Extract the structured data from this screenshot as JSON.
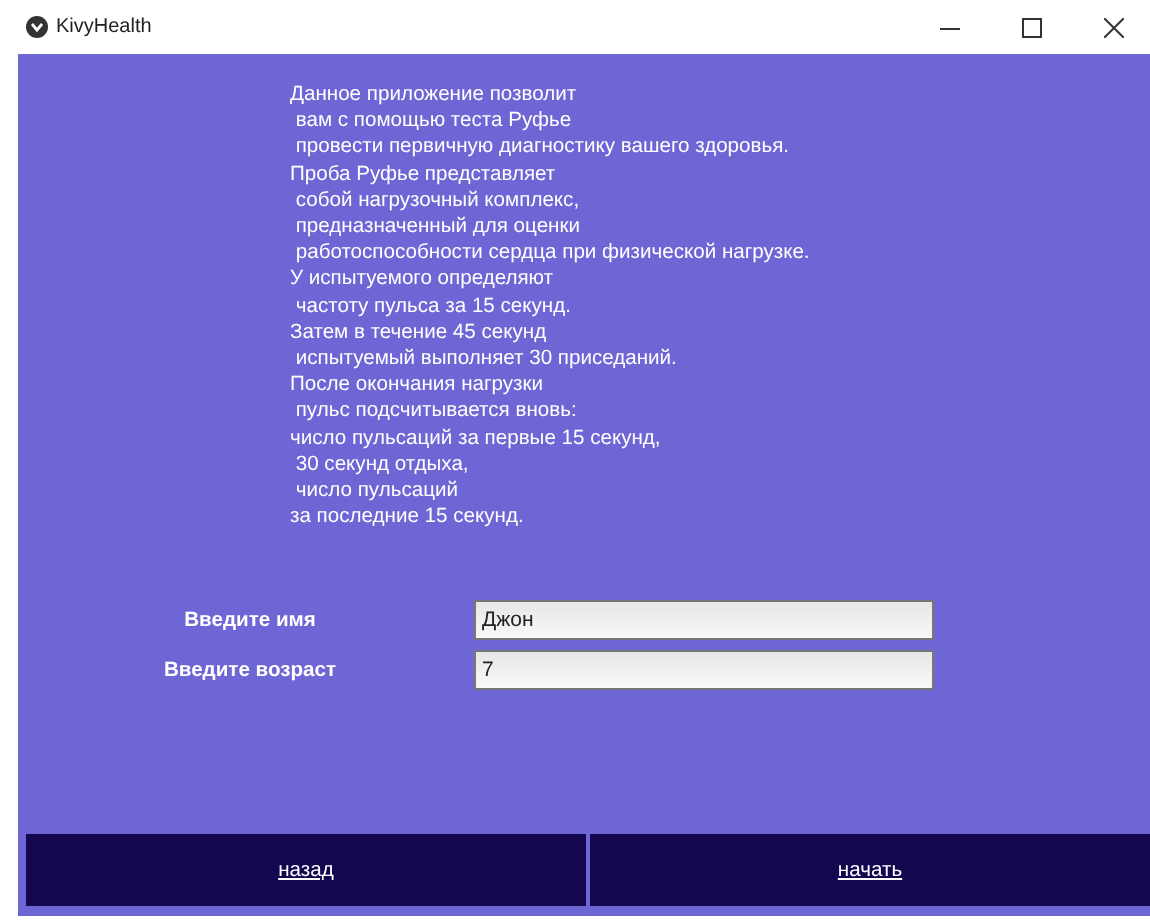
{
  "window": {
    "title": "KivyHealth"
  },
  "description": "Данное приложение позволит\n вам с помощью теста Руфье\n провести первичную диагностику вашего здоровья.\nПроба Руфье представляет\n собой нагрузочный комплекс,\n предназначенный для оценки\n работоспособности сердца при физической нагрузке.\nУ испытуемого определяют\n частоту пульса за 15 секунд.\nЗатем в течение 45 секунд\n испытуемый выполняет 30 приседаний.\nПосле окончания нагрузки\n пульс подсчитывается вновь:\nчисло пульсаций за первые 15 секунд,\n 30 секунд отдыха,\n число пульсаций\nза последние 15 секунд.",
  "fields": [
    {
      "label": "Введите имя",
      "value": "Джон"
    },
    {
      "label": "Введите возраст",
      "value": "7"
    }
  ],
  "buttons": [
    "назад",
    "начать"
  ]
}
